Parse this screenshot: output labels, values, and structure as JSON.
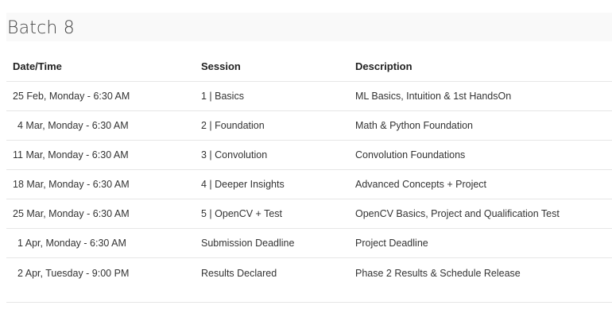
{
  "batch": {
    "title": "Batch 8"
  },
  "table": {
    "headers": {
      "date": "Date/Time",
      "session": "Session",
      "description": "Description"
    },
    "rows": [
      {
        "date": "25 Feb, Monday - 6:30 AM",
        "session": "1 | Basics",
        "description": "ML Basics, Intuition & 1st HandsOn"
      },
      {
        "date": "4 Mar, Monday - 6:30 AM",
        "session": "2 | Foundation",
        "description": "Math & Python Foundation"
      },
      {
        "date": "11 Mar, Monday - 6:30 AM",
        "session": "3 | Convolution",
        "description": "Convolution Foundations"
      },
      {
        "date": "18 Mar, Monday - 6:30 AM",
        "session": "4 | Deeper Insights",
        "description": "Advanced Concepts + Project"
      },
      {
        "date": "25 Mar, Monday - 6:30 AM",
        "session": "5 | OpenCV + Test",
        "description": "OpenCV Basics, Project and Qualification Test"
      },
      {
        "date": "1 Apr, Monday - 6:30 AM",
        "session": "Submission Deadline",
        "description": "Project Deadline"
      },
      {
        "date": "2 Apr, Tuesday - 9:00 PM",
        "session": "Results Declared",
        "description": "Phase 2 Results & Schedule Release"
      }
    ]
  }
}
